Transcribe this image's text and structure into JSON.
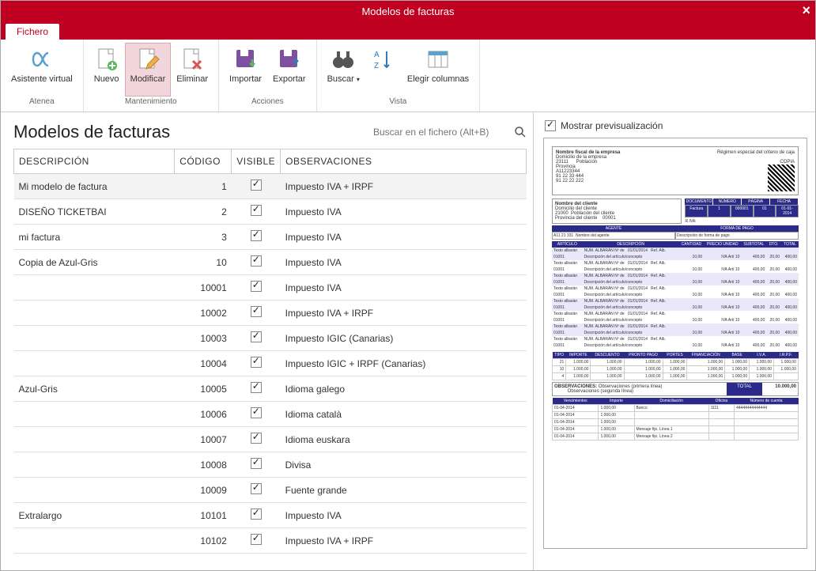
{
  "window": {
    "title": "Modelos de facturas"
  },
  "tabs": {
    "file": "Fichero"
  },
  "ribbon": {
    "groups": [
      {
        "label": "Atenea",
        "buttons": [
          {
            "label": "Asistente virtual",
            "icon": "alpha-icon"
          }
        ]
      },
      {
        "label": "Mantenimiento",
        "buttons": [
          {
            "label": "Nuevo",
            "icon": "doc-plus-icon"
          },
          {
            "label": "Modificar",
            "icon": "doc-pencil-icon",
            "selected": true
          },
          {
            "label": "Eliminar",
            "icon": "doc-x-icon"
          }
        ]
      },
      {
        "label": "Acciones",
        "buttons": [
          {
            "label": "Importar",
            "icon": "disk-down-icon"
          },
          {
            "label": "Exportar",
            "icon": "disk-up-icon"
          }
        ]
      },
      {
        "label": "Vista",
        "buttons": [
          {
            "label": "Buscar",
            "icon": "binoculars-icon",
            "dropdown": true
          },
          {
            "label": "",
            "icon": "sort-icon",
            "narrow": true
          },
          {
            "label": "Elegir columnas",
            "icon": "columns-icon"
          }
        ]
      }
    ]
  },
  "page": {
    "heading": "Modelos de facturas",
    "search_placeholder": "Buscar en el fichero (Alt+B)"
  },
  "table": {
    "headers": {
      "descripcion": "DESCRIPCIÓN",
      "codigo": "CÓDIGO",
      "visible": "VISIBLE",
      "observaciones": "OBSERVACIONES"
    },
    "rows": [
      {
        "descripcion": "Mi modelo de factura",
        "codigo": "1",
        "visible": true,
        "obs": "Impuesto IVA + IRPF",
        "selected": true
      },
      {
        "descripcion": " DISEÑO TICKETBAI",
        "codigo": "2",
        "visible": true,
        "obs": "Impuesto IVA"
      },
      {
        "descripcion": "mi factura",
        "codigo": "3",
        "visible": true,
        "obs": "Impuesto IVA"
      },
      {
        "descripcion": "Copia de Azul-Gris",
        "codigo": "10",
        "visible": true,
        "obs": "Impuesto IVA"
      },
      {
        "descripcion": "",
        "codigo": "10001",
        "visible": true,
        "obs": "Impuesto IVA"
      },
      {
        "descripcion": "",
        "codigo": "10002",
        "visible": true,
        "obs": "Impuesto IVA + IRPF"
      },
      {
        "descripcion": "",
        "codigo": "10003",
        "visible": true,
        "obs": "Impuesto IGIC (Canarias)"
      },
      {
        "descripcion": "",
        "codigo": "10004",
        "visible": true,
        "obs": "Impuesto IGIC + IRPF (Canarias)"
      },
      {
        "descripcion": "Azul-Gris",
        "codigo": "10005",
        "visible": true,
        "obs": "Idioma galego"
      },
      {
        "descripcion": "",
        "codigo": "10006",
        "visible": true,
        "obs": "Idioma català"
      },
      {
        "descripcion": "",
        "codigo": "10007",
        "visible": true,
        "obs": "Idioma euskara"
      },
      {
        "descripcion": "",
        "codigo": "10008",
        "visible": true,
        "obs": "Divisa"
      },
      {
        "descripcion": "",
        "codigo": "10009",
        "visible": true,
        "obs": "Fuente grande"
      },
      {
        "descripcion": "Extralargo",
        "codigo": "10101",
        "visible": true,
        "obs": "Impuesto IVA"
      },
      {
        "descripcion": "",
        "codigo": "10102",
        "visible": true,
        "obs": "Impuesto IVA + IRPF"
      }
    ]
  },
  "rightpane": {
    "show_preview_label": "Mostrar previsualización",
    "show_preview": true
  },
  "preview": {
    "company": "Nombre fiscal de la empresa",
    "company_addr": "Domicilio de la empresa",
    "zip": "23111",
    "poblacion": "Población",
    "provincia": "Provincia",
    "nif": "A11223344",
    "tel": "91 22 33 444",
    "fax": "91 22 22 222",
    "regimen": "Régimen especial del criterio de caja",
    "copia": "COPIA",
    "client": "Nombre del cliente",
    "client_addr": "Domicilio del cliente",
    "client_zip": "21000",
    "client_pob": "Población del cliente",
    "client_prov": "Provincia del cliente",
    "client_cp": "00001",
    "docbar": [
      "DOCUMENTO",
      "NÚMERO",
      "PÁGINA",
      "FECHA"
    ],
    "docbar2": [
      "Factura",
      "1",
      "000001",
      "01",
      "01-01-2014"
    ],
    "riva": "R.IVA:",
    "agente_h": "AGENTE",
    "agente_c": "A11 21 331",
    "agente_n": "Nombre del agente",
    "formapago_h": "FORMA DE PAGO",
    "formapago_d": "Descripción de forma de pago",
    "line_headers": [
      "ARTÍCULO",
      "DESCRIPCIÓN",
      "CANTIDAD",
      "PRECIO UNIDAD",
      "SUBTOTAL",
      "DTO.",
      "TOTAL"
    ],
    "lines_sample": {
      "art": "01001",
      "texto": "Texto albarán",
      "num": "NUM. ALBARÁN Nº de",
      "fecha": "01/01/2014",
      "refalb": "Ref. Alb.",
      "desc": "Descripción del artículo/concepto",
      "cant": "10,00",
      "precio": "IVA Artí  10",
      "sub": "400,00",
      "dto": "20,00",
      "total": "400,00"
    },
    "lines_count": 16,
    "tax_headers": [
      "TIPO",
      "IMPORTE",
      "DESCUENTO",
      "PRONTO PAGO",
      "PORTES",
      "FINANCIACIÓN",
      "BASE",
      "I.V.A.",
      "I.R.P.F."
    ],
    "tax_rows": [
      [
        "21",
        "1.000,00",
        "1.000,00",
        "1.000,00",
        "1.000,00",
        "1.000,00",
        "1.000,00",
        "1.000,00",
        "1.000,00"
      ],
      [
        "10",
        "1.000,00",
        "1.000,00",
        "1.000,00",
        "1.000,00",
        "1.000,00",
        "1.000,00",
        "1.000,00",
        "1.000,00"
      ],
      [
        "4",
        "1.000,00",
        "1.000,00",
        "1.000,00",
        "1.000,00",
        "1.000,00",
        "1.000,00",
        "1.000,00",
        ""
      ]
    ],
    "obs_label": "OBSERVACIONES:",
    "obs1": "Observaciones (primera línea)",
    "obs2": "Observaciones (segunda línea)",
    "total_label": "TOTAL",
    "total_value": "10.000,00",
    "venc_headers": [
      "Vencimientos",
      "Importe",
      "Domiciliación",
      "Oficina",
      "Número de cuenta"
    ],
    "venc_rows": [
      [
        "01-04-2014",
        "1.000,00",
        "Banco",
        "1111",
        "44444444444444"
      ],
      [
        "01-04-2014",
        "1.000,00",
        "",
        "",
        ""
      ],
      [
        "01-04-2014",
        "1.000,00",
        "",
        "",
        ""
      ],
      [
        "01-04-2014",
        "1.000,00",
        "Mensaje fijo. Línea 1",
        "",
        ""
      ],
      [
        "01-04-2014",
        "1.000,00",
        "Mensaje fijo. Línea 2",
        "",
        ""
      ]
    ]
  }
}
